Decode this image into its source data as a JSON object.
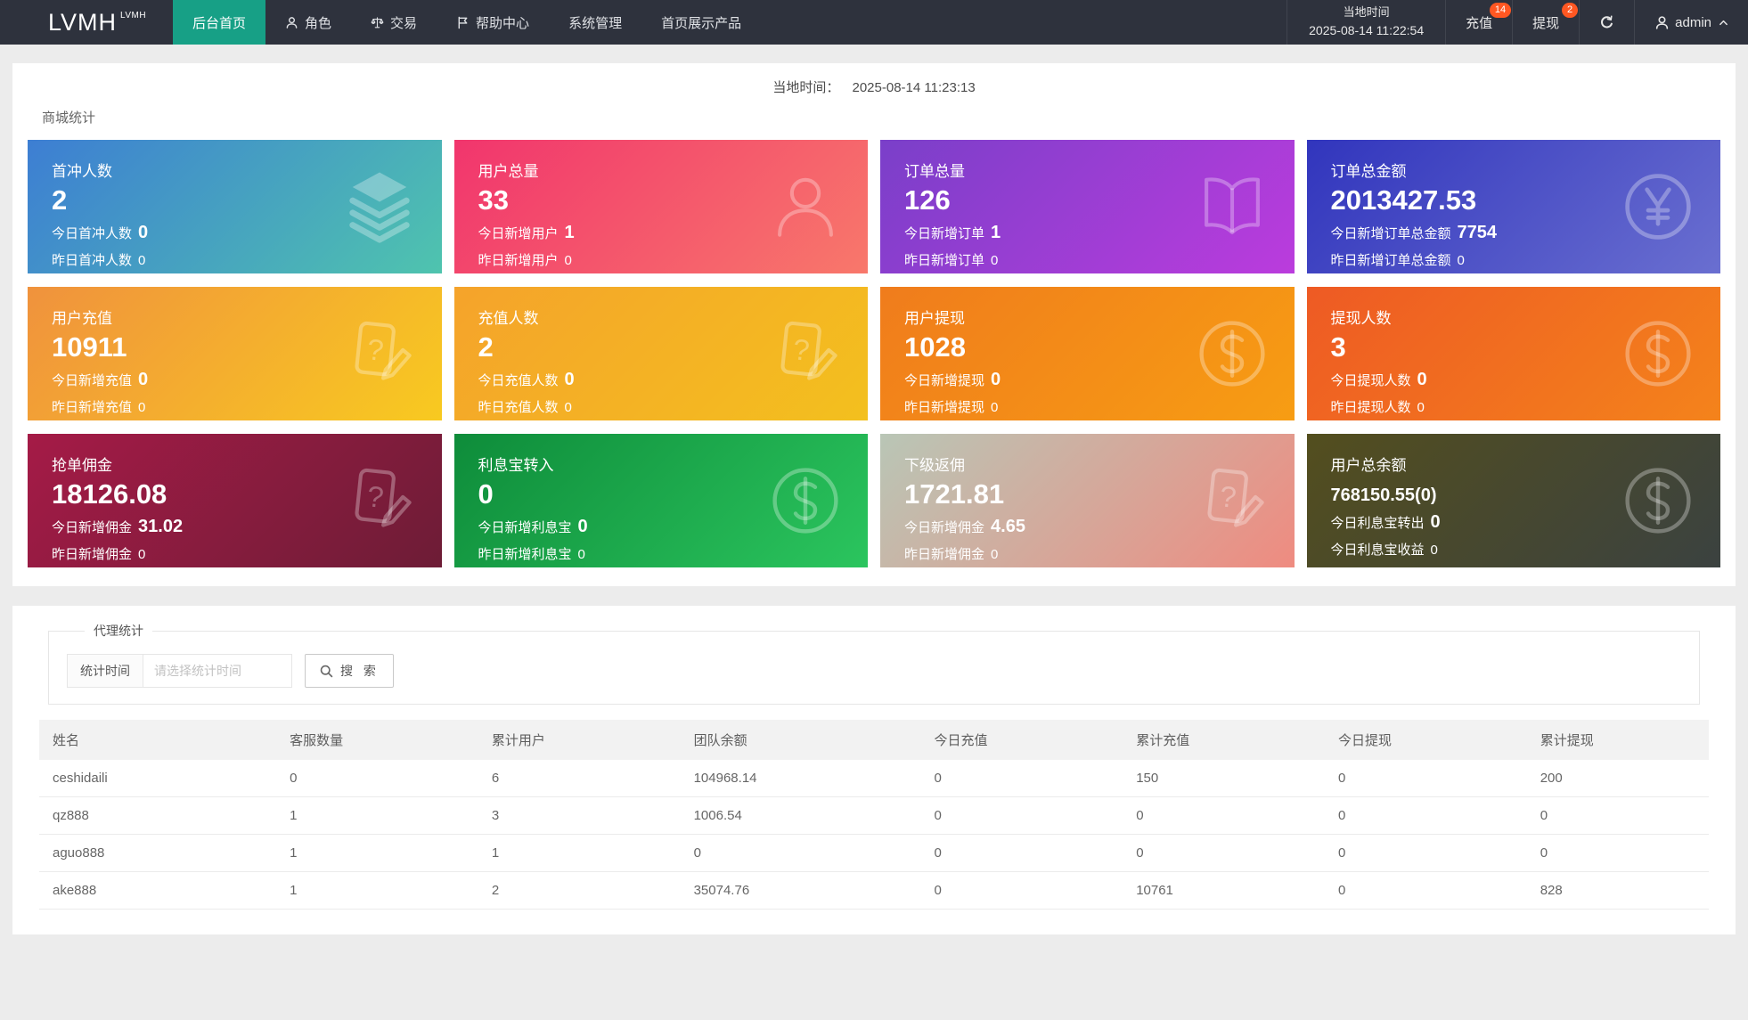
{
  "colors": {
    "navbar_bg": "#2e323d",
    "accent_green": "#17a086",
    "badge": "#ff5722"
  },
  "navbar": {
    "logo": "LVMH",
    "logo_sup": "LVMH",
    "menu": [
      {
        "label": "后台首页",
        "active": true
      },
      {
        "label": "角色",
        "icon": "person-sm"
      },
      {
        "label": "交易",
        "icon": "scales"
      },
      {
        "label": "帮助中心",
        "icon": "flag"
      },
      {
        "label": "系统管理"
      },
      {
        "label": "首页展示产品"
      }
    ],
    "local_time_label": "当地时间",
    "local_time_value": "2025-08-14 11:22:54",
    "recharge_label": "充值",
    "recharge_badge": "14",
    "withdraw_label": "提现",
    "withdraw_badge": "2",
    "user_name": "admin"
  },
  "stats_panel": {
    "time_label": "当地时间：",
    "time_value": "2025-08-14 11:23:13",
    "section_title": "商城统计",
    "cards": [
      {
        "title": "首冲人数",
        "value": "2",
        "line1_label": "今日首冲人数",
        "line1_value": "0",
        "line2_label": "昨日首冲人数",
        "line2_value": "0",
        "icon": "layers",
        "gradient": [
          "#3d7ed3",
          "#4fc4ae"
        ]
      },
      {
        "title": "用户总量",
        "value": "33",
        "line1_label": "今日新增用户",
        "line1_value": "1",
        "line2_label": "昨日新增用户",
        "line2_value": "0",
        "icon": "user",
        "gradient": [
          "#f1356d",
          "#f8786b"
        ]
      },
      {
        "title": "订单总量",
        "value": "126",
        "line1_label": "今日新增订单",
        "line1_value": "1",
        "line2_label": "昨日新增订单",
        "line2_value": "0",
        "icon": "book",
        "gradient": [
          "#7a3fc9",
          "#bb3cdd"
        ]
      },
      {
        "title": "订单总金额",
        "value": "2013427.53",
        "line1_label": "今日新增订单总金额",
        "line1_value": "7754",
        "line2_label": "昨日新增订单总金额",
        "line2_value": "0",
        "icon": "yen",
        "gradient": [
          "#3135bd",
          "#6a6fd0"
        ]
      },
      {
        "title": "用户充值",
        "value": "10911",
        "line1_label": "今日新增充值",
        "line1_value": "0",
        "line2_label": "昨日新增充值",
        "line2_value": "0",
        "icon": "doc-edit",
        "gradient": [
          "#f0923d",
          "#f8ca20"
        ]
      },
      {
        "title": "充值人数",
        "value": "2",
        "line1_label": "今日充值人数",
        "line1_value": "0",
        "line2_label": "昨日充值人数",
        "line2_value": "0",
        "icon": "doc-edit",
        "gradient": [
          "#f5a32b",
          "#f3c01e"
        ]
      },
      {
        "title": "用户提现",
        "value": "1028",
        "line1_label": "今日新增提现",
        "line1_value": "0",
        "line2_label": "昨日新增提现",
        "line2_value": "0",
        "icon": "dollar",
        "gradient": [
          "#f07c1c",
          "#f79d13"
        ]
      },
      {
        "title": "提现人数",
        "value": "3",
        "line1_label": "今日提现人数",
        "line1_value": "0",
        "line2_label": "昨日提现人数",
        "line2_value": "0",
        "icon": "dollar",
        "gradient": [
          "#ee5a24",
          "#f4831b"
        ]
      },
      {
        "title": "抢单佣金",
        "value": "18126.08",
        "line1_label": "今日新增佣金",
        "line1_value": "31.02",
        "line2_label": "昨日新增佣金",
        "line2_value": "0",
        "icon": "doc-edit",
        "gradient": [
          "#a51b47",
          "#6d1c36"
        ]
      },
      {
        "title": "利息宝转入",
        "value": "0",
        "line1_label": "今日新增利息宝",
        "line1_value": "0",
        "line2_label": "昨日新增利息宝",
        "line2_value": "0",
        "icon": "dollar",
        "gradient": [
          "#0e8c3a",
          "#2bc55e"
        ]
      },
      {
        "title": "下级返佣",
        "value": "1721.81",
        "line1_label": "今日新增佣金",
        "line1_value": "4.65",
        "line2_label": "昨日新增佣金",
        "line2_value": "0",
        "icon": "doc-edit",
        "gradient": [
          "#b9c6b6",
          "#ef8b80"
        ]
      },
      {
        "title": "用户总余额",
        "value": "768150.55(0)",
        "line1_label": "今日利息宝转出",
        "line1_value": "0",
        "line2_label": "今日利息宝收益",
        "line2_value": "0",
        "icon": "dollar",
        "gradient": [
          "#534e1e",
          "#3b4240"
        ],
        "small_value": true
      }
    ]
  },
  "agent_panel": {
    "legend": "代理统计",
    "filter_label": "统计时间",
    "filter_placeholder": "请选择统计时间",
    "search_label": "搜 索",
    "table": {
      "headers": [
        "姓名",
        "客服数量",
        "累计用户",
        "团队余额",
        "今日充值",
        "累计充值",
        "今日提现",
        "累计提现"
      ],
      "rows": [
        [
          "ceshidaili",
          "0",
          "6",
          "104968.14",
          "0",
          "150",
          "0",
          "200"
        ],
        [
          "qz888",
          "1",
          "3",
          "1006.54",
          "0",
          "0",
          "0",
          "0"
        ],
        [
          "aguo888",
          "1",
          "1",
          "0",
          "0",
          "0",
          "0",
          "0"
        ],
        [
          "ake888",
          "1",
          "2",
          "35074.76",
          "0",
          "10761",
          "0",
          "828"
        ]
      ]
    }
  }
}
